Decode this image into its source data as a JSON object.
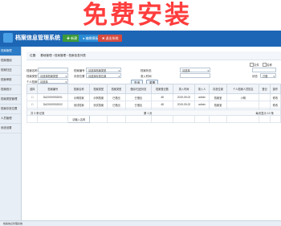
{
  "banner": {
    "text": "免费安装"
  },
  "app": {
    "title": "档案信息管理系统"
  },
  "topbar": {
    "buttons": [
      {
        "label": "✚ 新建",
        "color": "#3c9a3a"
      },
      {
        "label": "● 编辑模板",
        "color": "#2a8ad4"
      },
      {
        "label": "✖ 退出系统",
        "color": "#d64a3f"
      }
    ]
  },
  "sidebar": {
    "items": [
      {
        "label": "档案管理",
        "active": true
      },
      {
        "label": "档案借阅",
        "active": false
      },
      {
        "label": "档案归还",
        "active": false
      },
      {
        "label": "档案审核",
        "active": false
      },
      {
        "label": "档案统计",
        "active": false
      },
      {
        "label": "档案类型管理",
        "active": false
      },
      {
        "label": "档案存放位置",
        "active": false
      },
      {
        "label": "人员管理",
        "active": false
      },
      {
        "label": "系统设置",
        "active": false
      }
    ]
  },
  "breadcrumb": {
    "prefix": "位置:",
    "parts": [
      "基础管理",
      "档案管理",
      "档案信息列表"
    ]
  },
  "filters": {
    "row1_label_a": "档案名称",
    "row1_label_b": "档案编号",
    "row1_select_b": "请选择档案类型",
    "row1_label_c": "档案状态",
    "row1_select_c": "请选择",
    "row1_check_a": "文件",
    "row1_check_b": "名称",
    "row2_label_a": "档案类型",
    "row2_select_a": "请选择档案类型",
    "row2_label_b": "存放位置",
    "row2_select_b": "请选择存放位置",
    "row2_label_c": "录入时间",
    "row2_right_label": "状态",
    "row2_select_c": "已借",
    "row3_label_a": "个人档案",
    "row3_select_a": "请选择"
  },
  "actions": {
    "search": "查询",
    "reset": "重置"
  },
  "table": {
    "headers": [
      "选择",
      "档案编号",
      "档案名称",
      "档案类型",
      "档案类型",
      "借阅/归还状态",
      "档案登记数",
      "录入时间",
      "录入人",
      "存放位置",
      "个人档案人员姓名",
      "登记",
      "操作"
    ],
    "rows": [
      [
        "",
        "DA20190902001",
        "示例档案",
        "示例档案",
        "已借出",
        "已借出",
        "48",
        "2019-09-02",
        "admin",
        "档案室",
        "小明",
        "",
        "修改"
      ],
      [
        "",
        "DA20190902002",
        "测试档案",
        "测试档案",
        "已借出",
        "已借出",
        "48",
        "2019-09-02",
        "admin",
        "档案室",
        "",
        "",
        "修改"
      ],
      [
        "",
        "DA20190902003",
        "test",
        "测试档案",
        "已借出",
        "已借出",
        "48",
        "2019-09-02",
        "admin",
        "档案室",
        "大学",
        "",
        "修改"
      ],
      [
        "",
        "",
        "请输入名称",
        "",
        "",
        "",
        "",
        "",
        "",
        "",
        "",
        "",
        ""
      ]
    ]
  },
  "pager": {
    "left": "共 3 条记录",
    "page": "第 1 页",
    "right": "每页显示 10 条"
  },
  "footer": {
    "text": "档案信息管理系统"
  }
}
